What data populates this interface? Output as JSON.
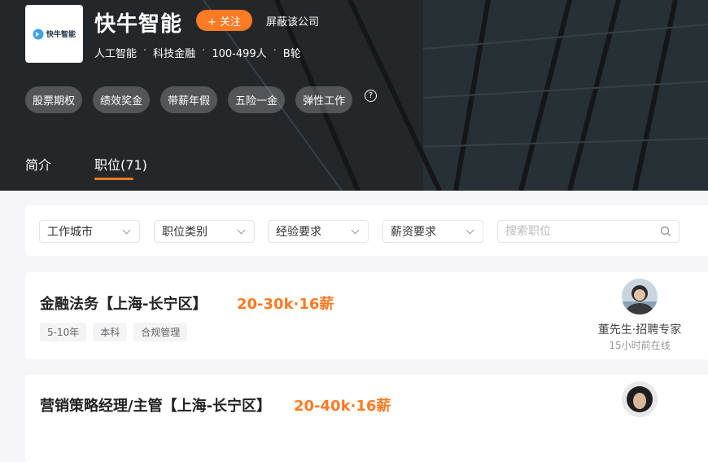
{
  "company": {
    "logo_text": "快牛智能",
    "name": "快牛智能",
    "follow_label": "+ 关注",
    "block_label": "屏蔽该公司",
    "meta": [
      "人工智能",
      "科技金融",
      "100-499人",
      "B轮"
    ]
  },
  "benefits": [
    "股票期权",
    "绩效奖金",
    "带薪年假",
    "五险一金",
    "弹性工作"
  ],
  "tabs": [
    {
      "label": "简介",
      "active": false
    },
    {
      "label": "职位(71)",
      "active": true
    }
  ],
  "filters": {
    "selects": [
      "工作城市",
      "职位类别",
      "经验要求",
      "薪资要求"
    ],
    "search_placeholder": "搜索职位"
  },
  "jobs": [
    {
      "title": "金融法务【上海-长宁区】",
      "salary": "20-30k·16薪",
      "tags": [
        "5-10年",
        "本科",
        "合规管理"
      ],
      "recruiter": "董先生·招聘专家",
      "online": "15小时前在线"
    },
    {
      "title": "营销策略经理/主管【上海-长宁区】",
      "salary": "20-40k·16薪"
    }
  ],
  "colors": {
    "accent": "#fe7a24"
  }
}
